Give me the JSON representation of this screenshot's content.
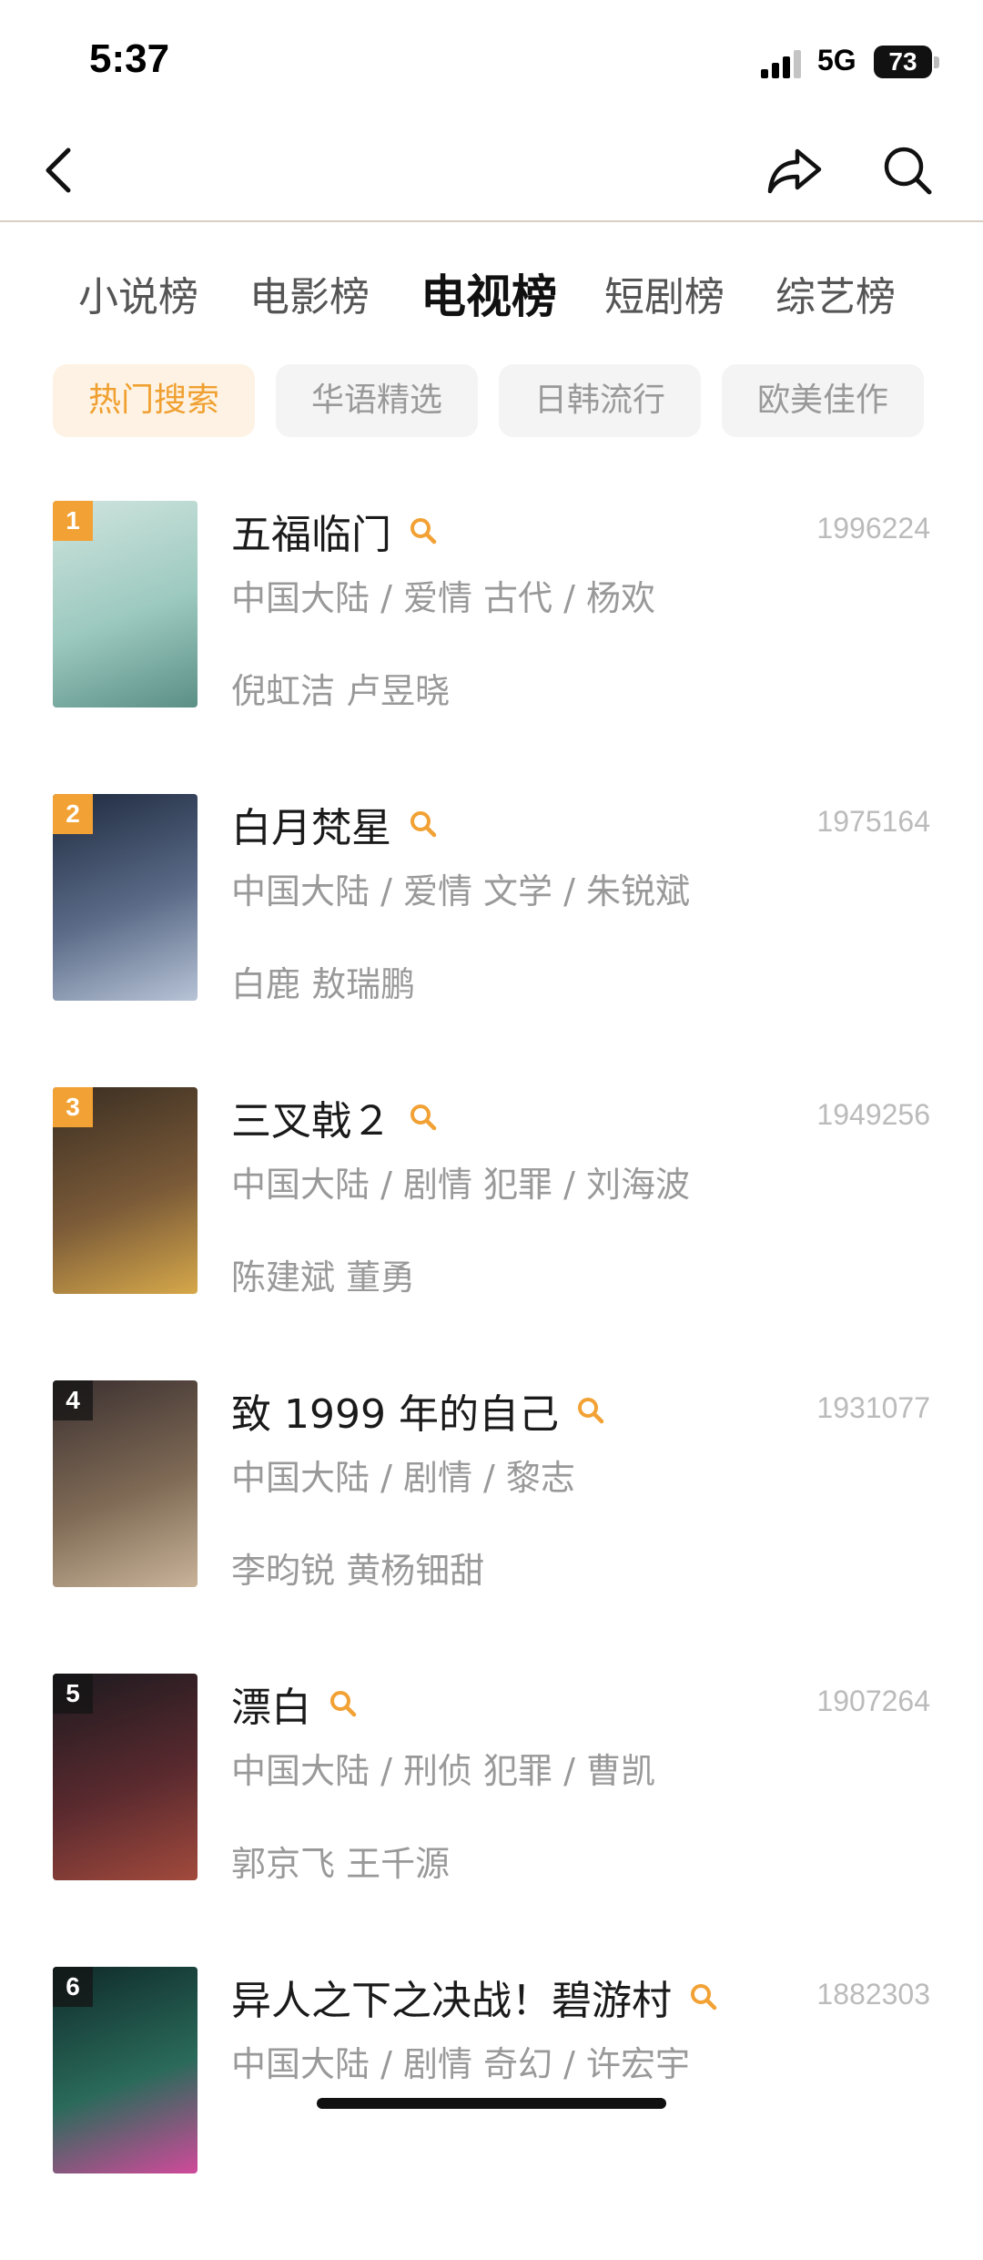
{
  "status_bar": {
    "time": "5:37",
    "network": "5G",
    "battery": "73"
  },
  "tabs": [
    {
      "label": "小说榜",
      "active": false
    },
    {
      "label": "电影榜",
      "active": false
    },
    {
      "label": "电视榜",
      "active": true
    },
    {
      "label": "短剧榜",
      "active": false
    },
    {
      "label": "综艺榜",
      "active": false
    }
  ],
  "chips": [
    {
      "label": "热门搜索",
      "active": true
    },
    {
      "label": "华语精选",
      "active": false
    },
    {
      "label": "日韩流行",
      "active": false
    },
    {
      "label": "欧美佳作",
      "active": false
    }
  ],
  "colors": {
    "accent": "#f2a134",
    "chip_active_bg": "#fdf2e3",
    "divider": "#d8cfc2"
  },
  "list": [
    {
      "rank": "1",
      "title": "五福临门",
      "count": "1996224",
      "meta": "中国大陆 / 爱情 古代 / 杨欢",
      "cast": "倪虹洁 卢昱晓",
      "poster_colors": [
        "#cfe4de",
        "#9cc9bf",
        "#5b8f86"
      ]
    },
    {
      "rank": "2",
      "title": "白月梵星",
      "count": "1975164",
      "meta": "中国大陆 / 爱情 文学 / 朱锐斌",
      "cast": "白鹿 敖瑞鹏",
      "poster_colors": [
        "#1e2a3f",
        "#5b6b88",
        "#b7c3d6"
      ]
    },
    {
      "rank": "3",
      "title": "三叉戟２",
      "count": "1949256",
      "meta": "中国大陆 / 剧情 犯罪 / 刘海波",
      "cast": "陈建斌 董勇",
      "poster_colors": [
        "#3a2e22",
        "#7a5a38",
        "#d6a84a"
      ]
    },
    {
      "rank": "4",
      "title": "致 1999 年的自己",
      "count": "1931077",
      "meta": "中国大陆 / 剧情 / 黎志",
      "cast": "李昀锐 黄杨钿甜",
      "poster_colors": [
        "#3b3030",
        "#7f6a55",
        "#c9b49a"
      ]
    },
    {
      "rank": "5",
      "title": "漂白",
      "count": "1907264",
      "meta": "中国大陆 / 刑侦 犯罪 / 曹凯",
      "cast": "郭京飞 王千源",
      "poster_colors": [
        "#1c1a1f",
        "#5a2a2f",
        "#a24a3c"
      ]
    },
    {
      "rank": "6",
      "title": "异人之下之决战！碧游村",
      "count": "1882303",
      "meta": "中国大陆 / 剧情 奇幻 / 许宏宇",
      "cast": "",
      "poster_colors": [
        "#0f2a2a",
        "#2a6a5a",
        "#d04a9a"
      ]
    }
  ]
}
